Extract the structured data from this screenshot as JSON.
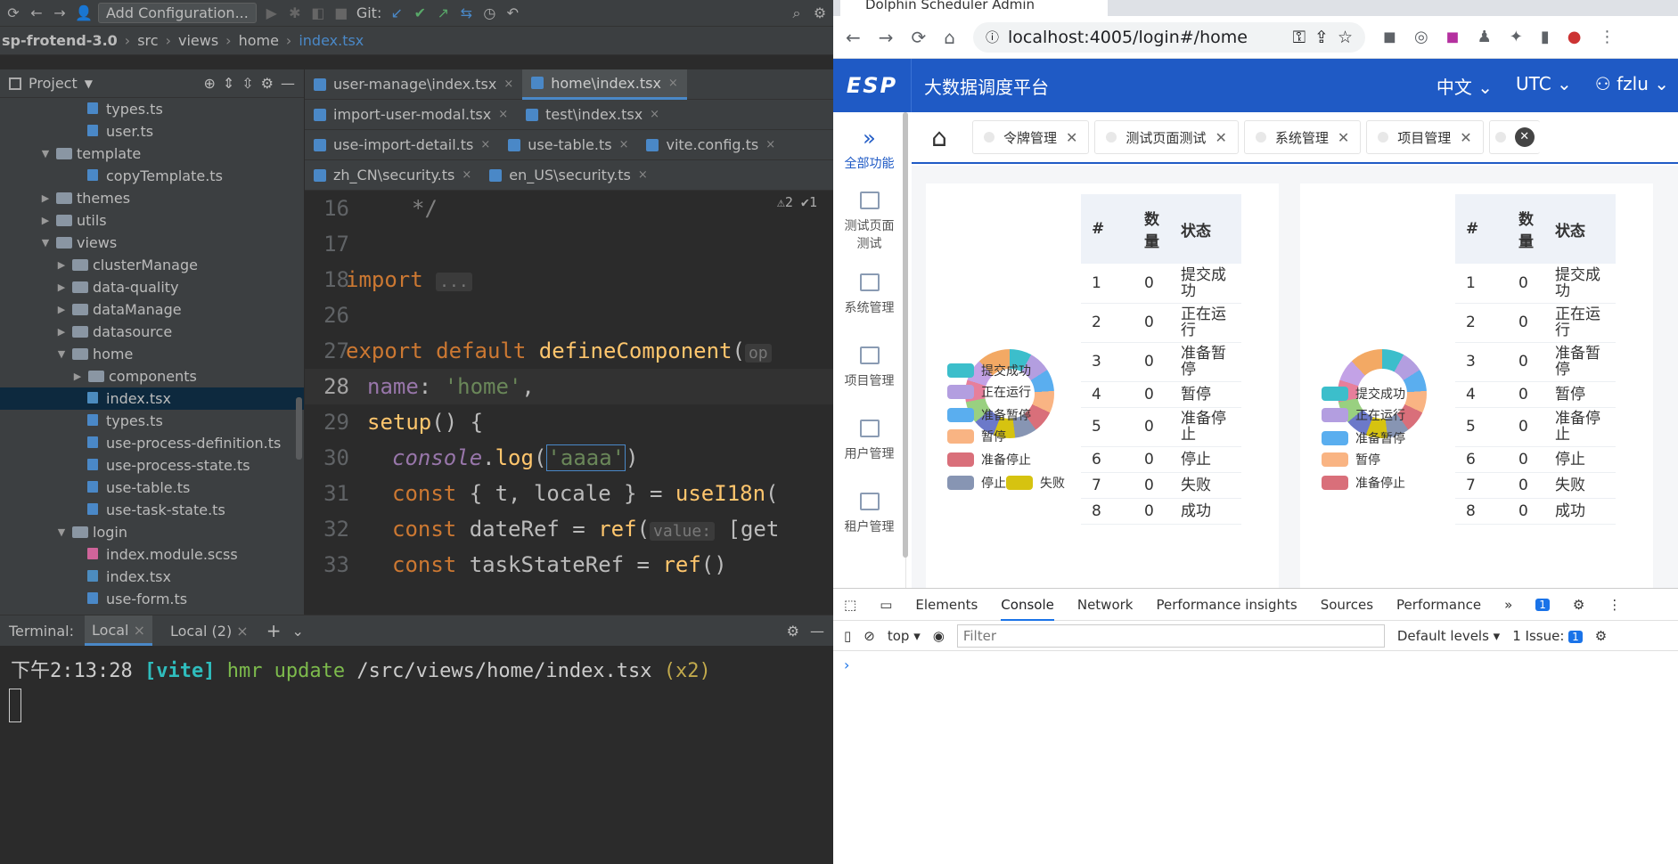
{
  "ide": {
    "toolbar": {
      "add_config": "Add Configuration...",
      "git_label": "Git:"
    },
    "breadcrumb": [
      "sp-frotend-3.0",
      "src",
      "views",
      "home",
      "index.tsx"
    ],
    "project": {
      "title": "Project",
      "tree": [
        {
          "name": "types.ts",
          "depth": 4,
          "kind": "ts"
        },
        {
          "name": "user.ts",
          "depth": 4,
          "kind": "ts"
        },
        {
          "name": "template",
          "depth": 2,
          "kind": "folder",
          "open": true
        },
        {
          "name": "copyTemplate.ts",
          "depth": 4,
          "kind": "ts"
        },
        {
          "name": "themes",
          "depth": 2,
          "kind": "folder"
        },
        {
          "name": "utils",
          "depth": 2,
          "kind": "folder"
        },
        {
          "name": "views",
          "depth": 2,
          "kind": "folder",
          "open": true
        },
        {
          "name": "clusterManage",
          "depth": 3,
          "kind": "folder"
        },
        {
          "name": "data-quality",
          "depth": 3,
          "kind": "folder"
        },
        {
          "name": "dataManage",
          "depth": 3,
          "kind": "folder"
        },
        {
          "name": "datasource",
          "depth": 3,
          "kind": "folder"
        },
        {
          "name": "home",
          "depth": 3,
          "kind": "folder",
          "open": true
        },
        {
          "name": "components",
          "depth": 4,
          "kind": "folder"
        },
        {
          "name": "index.tsx",
          "depth": 4,
          "kind": "tsx",
          "selected": true
        },
        {
          "name": "types.ts",
          "depth": 4,
          "kind": "ts"
        },
        {
          "name": "use-process-definition.ts",
          "depth": 4,
          "kind": "ts"
        },
        {
          "name": "use-process-state.ts",
          "depth": 4,
          "kind": "ts"
        },
        {
          "name": "use-table.ts",
          "depth": 4,
          "kind": "ts"
        },
        {
          "name": "use-task-state.ts",
          "depth": 4,
          "kind": "ts"
        },
        {
          "name": "login",
          "depth": 3,
          "kind": "folder",
          "open": true
        },
        {
          "name": "index.module.scss",
          "depth": 4,
          "kind": "scss"
        },
        {
          "name": "index.tsx",
          "depth": 4,
          "kind": "tsx"
        },
        {
          "name": "use-form.ts",
          "depth": 4,
          "kind": "ts"
        }
      ]
    },
    "editor_tabs": [
      [
        {
          "label": "user-manage\\index.tsx"
        },
        {
          "label": "home\\index.tsx",
          "active": true
        }
      ],
      [
        {
          "label": "import-user-modal.tsx"
        },
        {
          "label": "test\\index.tsx"
        }
      ],
      [
        {
          "label": "use-import-detail.ts"
        },
        {
          "label": "use-table.ts"
        },
        {
          "label": "vite.config.ts"
        }
      ],
      [
        {
          "label": "zh_CN\\security.ts"
        },
        {
          "label": "en_US\\security.ts"
        }
      ]
    ],
    "inspections": "⚠2 ✔1",
    "code": {
      "lines": [
        "16",
        "17",
        "18",
        "26",
        "27",
        "28",
        "29",
        "30",
        "31",
        "32",
        "33"
      ]
    },
    "terminal": {
      "label": "Terminal:",
      "tabs": [
        "Local",
        "Local (2)"
      ],
      "time": "下午2:13:28",
      "tag": "[vite]",
      "msg": "hmr update",
      "path": "/src/views/home/index.tsx",
      "count": "(x2)"
    }
  },
  "browser": {
    "tab_title": "Dolphin Scheduler Admin",
    "url": "localhost:4005/login#/home",
    "app": {
      "logo": "ESP",
      "title": "大数据调度平台",
      "lang": "中文",
      "tz": "UTC",
      "user": "fzlu"
    },
    "side": [
      "全部功能",
      "测试页面测试",
      "系统管理",
      "项目管理",
      "用户管理",
      "租户管理"
    ],
    "page_tabs": [
      "令牌管理",
      "测试页面测试",
      "系统管理",
      "项目管理"
    ],
    "table": {
      "headers": [
        "#",
        "数量",
        "状态"
      ],
      "rows": [
        [
          "1",
          "0",
          "提交成功"
        ],
        [
          "2",
          "0",
          "正在运行"
        ],
        [
          "3",
          "0",
          "准备暂停"
        ],
        [
          "4",
          "0",
          "暂停"
        ],
        [
          "5",
          "0",
          "准备停止"
        ],
        [
          "6",
          "0",
          "停止"
        ],
        [
          "7",
          "0",
          "失败"
        ],
        [
          "8",
          "0",
          "成功"
        ]
      ]
    },
    "legend_left": [
      "提交成功",
      "正在运行",
      "准备暂停",
      "暂停",
      "准备停止",
      "停止",
      "失败"
    ],
    "legend_right": [
      "提交成功",
      "正在运行",
      "准备暂停",
      "暂停",
      "准备停止"
    ],
    "colors": {
      "s1": "#3cbecb",
      "s2": "#b39ee0",
      "s3": "#5aaeef",
      "s4": "#f9b483",
      "s5": "#d96f7a",
      "s6": "#8795b3",
      "s7": "#d6c310"
    },
    "devtools": {
      "tabs": [
        "Elements",
        "Console",
        "Network",
        "Performance insights",
        "Sources",
        "Performance"
      ],
      "active_tab": "Console",
      "context": "top",
      "filter_placeholder": "Filter",
      "levels": "Default levels",
      "issues": "1 Issue:",
      "issue_count": "1",
      "msg_count": "1"
    }
  }
}
